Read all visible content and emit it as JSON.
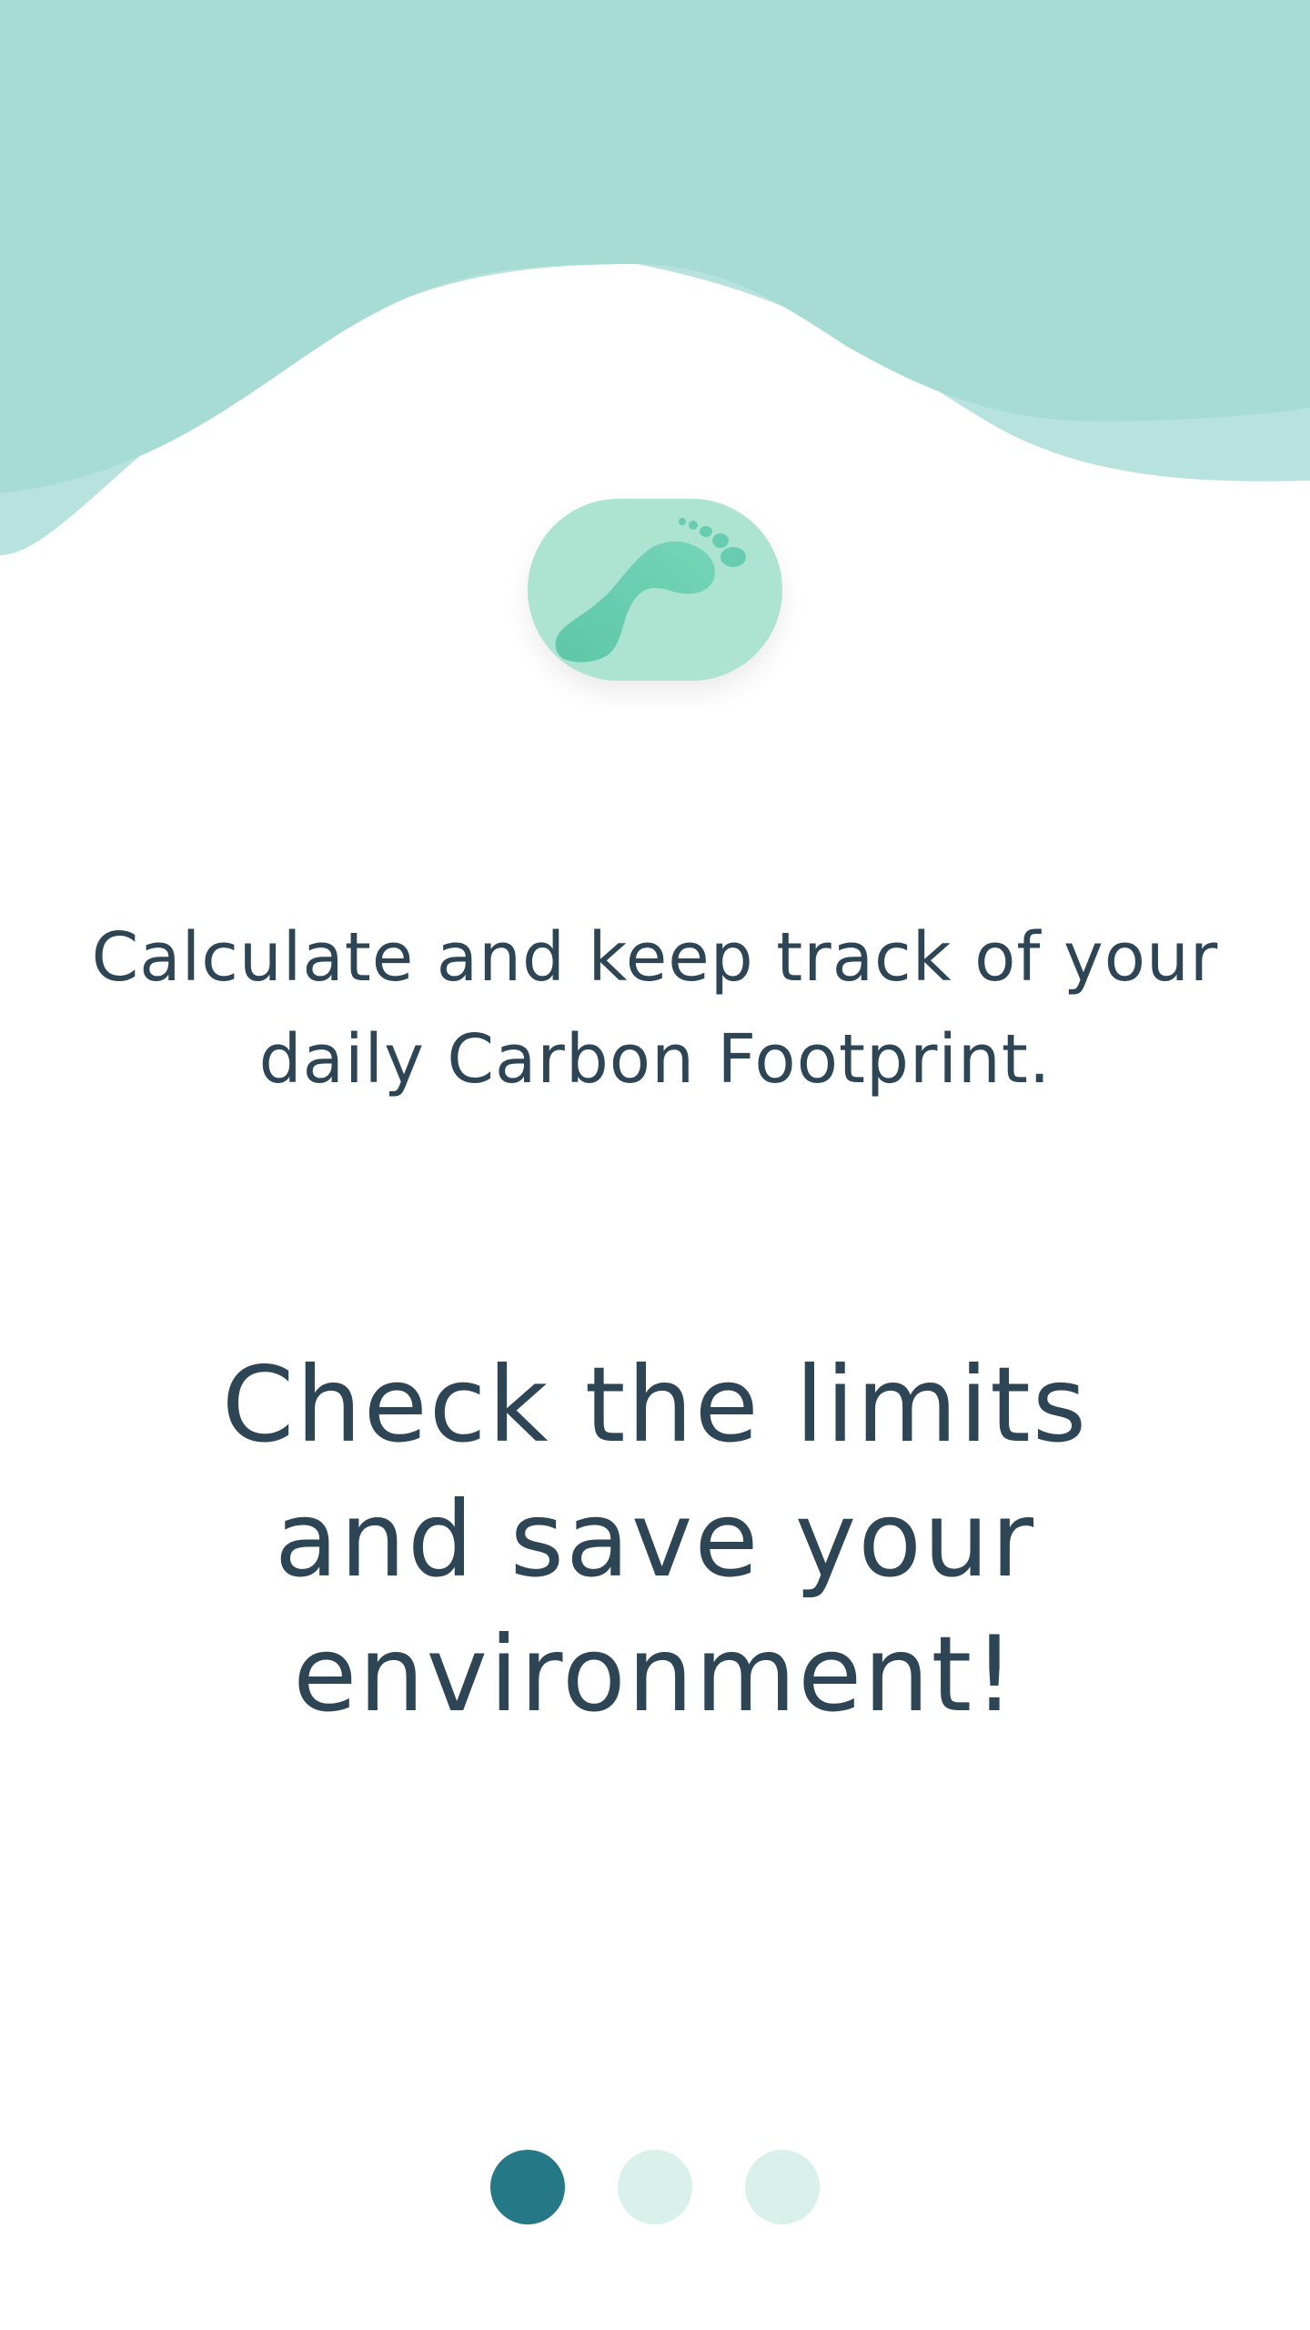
{
  "app": {
    "logo_icon": "footprint-icon"
  },
  "intro": {
    "tagline": "Calculate and keep track of your daily Carbon Footprint.",
    "headline": "Check the limits and save your environment!"
  },
  "pager": {
    "total": 3,
    "active_index": 0
  },
  "colors": {
    "wave_primary": "#a6dcd3",
    "wave_secondary": "#b7e2dd",
    "logo_bg": "#ade3d1",
    "footprint": "#67cdb0",
    "text": "#2e4556",
    "dot_active": "#257987",
    "dot_inactive": "#d9f1ea"
  }
}
